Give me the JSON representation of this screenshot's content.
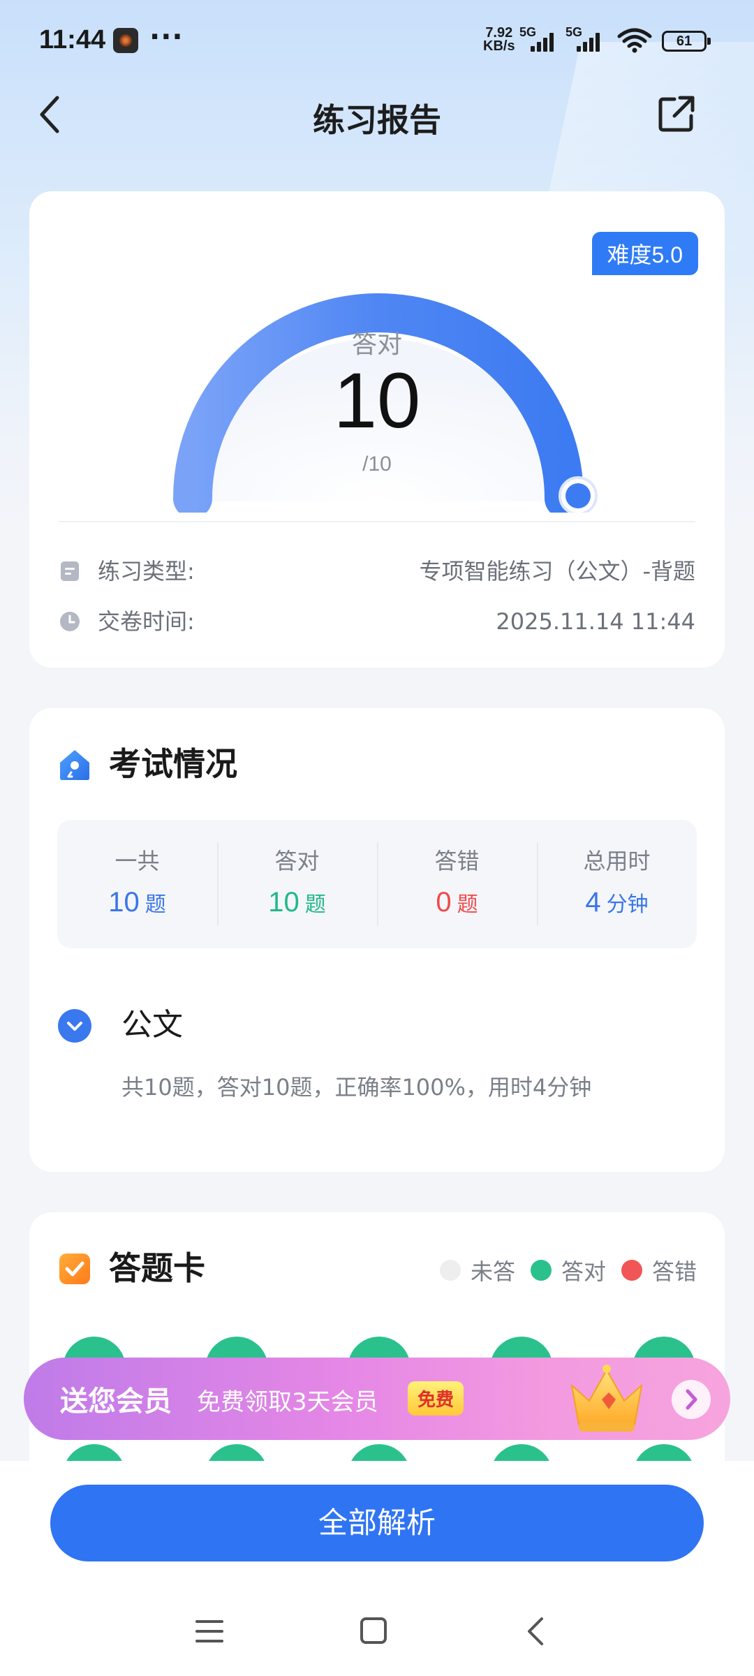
{
  "status_bar": {
    "time": "11:44",
    "net_speed_value": "7.92",
    "net_speed_unit": "KB/s",
    "signal1": "5G",
    "signal2": "5G",
    "battery": "61"
  },
  "header": {
    "title": "练习报告",
    "back_icon": "chevron-left-icon",
    "share_icon": "share-external-icon"
  },
  "score_card": {
    "difficulty": "难度5.0",
    "gauge_label": "答对",
    "correct": "10",
    "total": "/10",
    "progress": 1.0,
    "type_label": "练习类型:",
    "type_value": "专项智能练习（公文）-背题",
    "time_label": "交卷时间:",
    "time_value": "2025.11.14 11:44"
  },
  "exam_card": {
    "title": "考试情况",
    "stats": [
      {
        "label": "一共",
        "value": "10",
        "unit": "题",
        "color": "#3a76e6"
      },
      {
        "label": "答对",
        "value": "10",
        "unit": "题",
        "color": "#22b887"
      },
      {
        "label": "答错",
        "value": "0",
        "unit": "题",
        "color": "#ef4a4a"
      },
      {
        "label": "总用时",
        "value": "4",
        "unit": "分钟",
        "color": "#3a76e6"
      }
    ],
    "subject": "公文",
    "subject_summary": "共10题，答对10题，正确率100%，用时4分钟"
  },
  "answer_card": {
    "title": "答题卡",
    "legend": [
      {
        "label": "未答",
        "color": "#eeeeee"
      },
      {
        "label": "答对",
        "color": "#2bc18d"
      },
      {
        "label": "答错",
        "color": "#f05656"
      }
    ],
    "answers": [
      "correct",
      "correct",
      "correct",
      "correct",
      "correct",
      "correct",
      "correct",
      "correct",
      "correct",
      "correct"
    ]
  },
  "promo": {
    "main": "送您会员",
    "sub": "免费领取3天会员",
    "tag": "免费"
  },
  "bottom": {
    "button": "全部解析"
  },
  "colors": {
    "primary": "#2f74f2",
    "correct": "#2bc18d",
    "wrong": "#f05656"
  }
}
